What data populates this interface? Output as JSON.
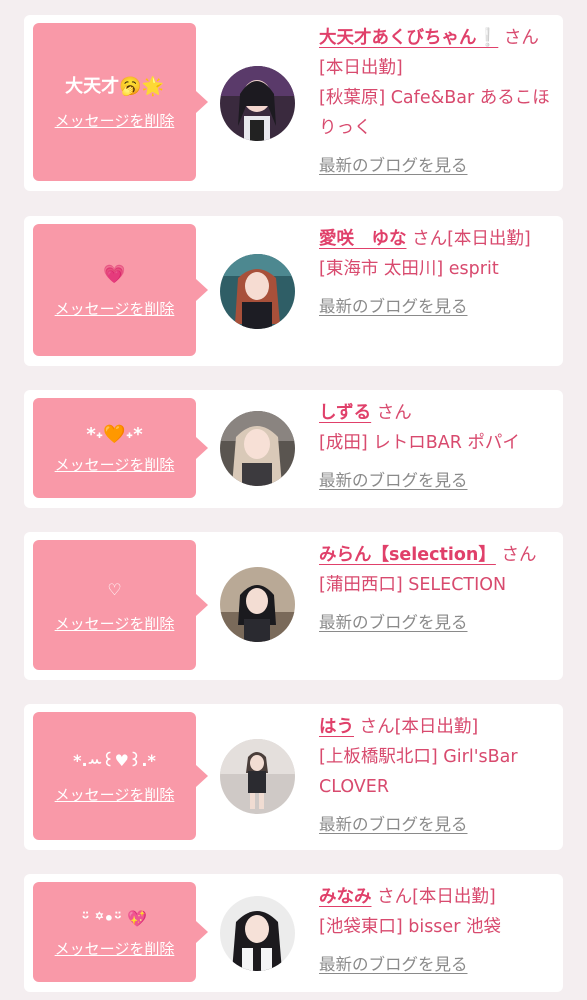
{
  "delete_label": "メッセージを削除",
  "blog_label": "最新のブログを見る",
  "colors": {
    "accent_pink": "#f999a8",
    "name_pink": "#e0406a",
    "text_pink": "#d84a6e",
    "link_gray": "#8a8a8a",
    "background": "#f4eef0"
  },
  "entries": [
    {
      "message": "大天才🥱🌟",
      "name": "大天才あくびちゃん❕",
      "suffix": " さん[本日出勤]",
      "shop": "[秋葉原] Cafe&Bar あるこほりっく"
    },
    {
      "message": "💗",
      "name": "愛咲　ゆな",
      "suffix": " さん[本日出勤]",
      "shop": "[東海市 太田川] esprit"
    },
    {
      "message": "*˖🧡˖*",
      "name": "しずる",
      "suffix": " さん",
      "shop": "[成田] レトロBAR ポパイ"
    },
    {
      "message": "♡",
      "name": "みらん【selection】",
      "suffix": " さん",
      "shop": "[蒲田西口] SELECTION"
    },
    {
      "message": "*.ꕀ꒰♥︎꒱.*",
      "name": "はう",
      "suffix": " さん[本日出勤]",
      "shop": "[上板橋駅北口] Girl'sBar CLOVER"
    },
    {
      "message": "ᵕ̈ ꙳•ᵕ̈ 💖",
      "name": "みなみ",
      "suffix": " さん[本日出勤]",
      "shop": "[池袋東口] bisser 池袋"
    }
  ]
}
